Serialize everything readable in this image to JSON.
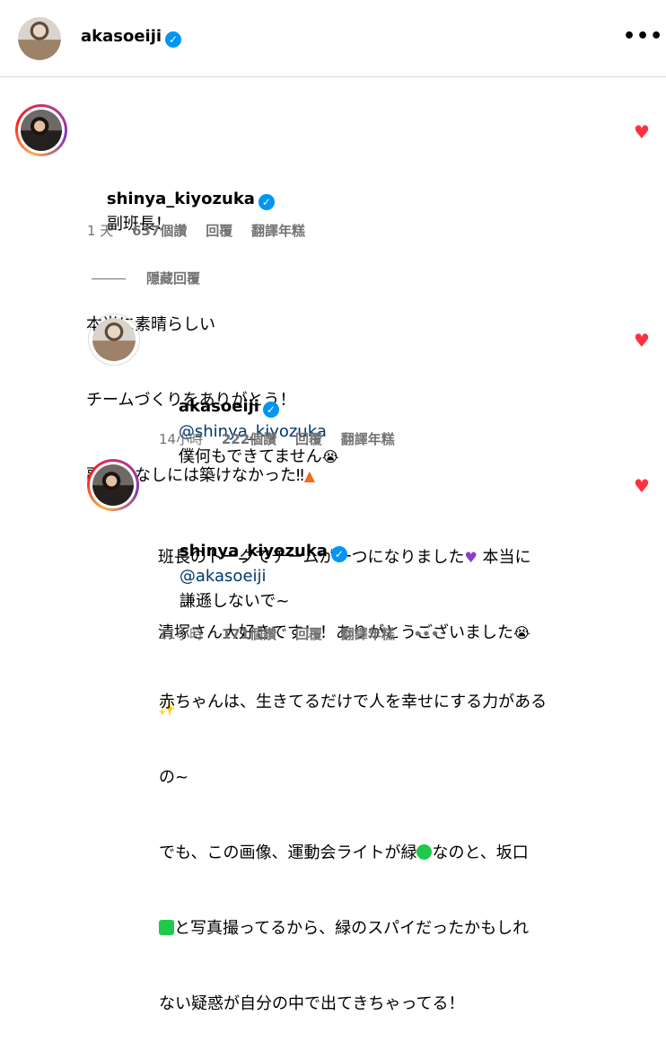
{
  "header": {
    "username": "akasoeiji",
    "verified_icon": "verified-badge-icon",
    "more_icon": "more-icon"
  },
  "comment1": {
    "username": "shinya_kiyozuka",
    "text_line1": "副班長！",
    "text_line2": "本当に素晴らしい",
    "text_line3": "チームづくりをありがとう！",
    "text_line4": "副班長なしには築けなかった‼",
    "time": "1 天",
    "likes": "637個讚",
    "reply": "回覆",
    "translate": "翻譯年糕"
  },
  "hide_replies": "隱藏回覆",
  "reply1": {
    "username": "akasoeiji",
    "mention": "@shinya_kiyozuka",
    "text_line1": "僕何もできてません",
    "text_line2": "班長のトークでチームが一つになりました",
    "text_line2b": "本当に",
    "text_line3": "清塚さん大好きです！！ありがとうございました",
    "time": "14小時",
    "likes": "222個讚",
    "reply": "回覆",
    "translate": "翻譯年糕"
  },
  "reply2": {
    "username": "shinya_kiyozuka",
    "mention": "@akasoeiji",
    "text_line1": "謙遜しないで~",
    "text_line2": "赤ちゃんは、生きてるだけで人を幸せにする力がある",
    "text_line3": "の~",
    "text_line4a": "でも、この画像、運動会ライトが緑",
    "text_line4b": "なのと、坂口",
    "text_line5": "と写真撮ってるから、緑のスパイだったかもしれ",
    "text_line6": "ない疑惑が自分の中で出てきちゃってる！",
    "time": "11小時",
    "likes": "171個讚",
    "reply": "回覆",
    "translate": "翻譯年糕",
    "more": "•••"
  },
  "colors": {
    "like": "#ff3040",
    "verified": "#0095f6",
    "green": "#1fc94a",
    "mention": "#00376b"
  }
}
